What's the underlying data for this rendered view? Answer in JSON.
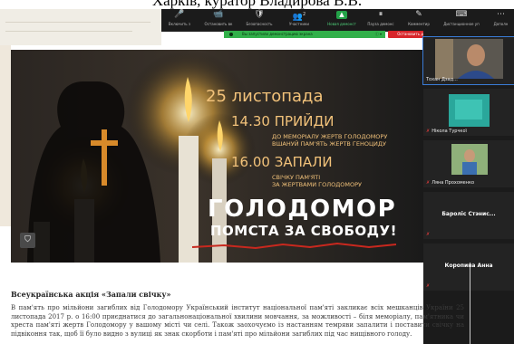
{
  "caption": {
    "text": "Харків, куратор Владирова В.В."
  },
  "zoom_toolbar": {
    "items": [
      {
        "icon": "🎤",
        "label": "Включить з"
      },
      {
        "icon": "📹",
        "label": "Остановить вк"
      },
      {
        "icon": "🛡",
        "label": "Безопасность"
      },
      {
        "icon": "👥",
        "label": "Участники"
      },
      {
        "icon": "▲",
        "label": "Новая демонст"
      },
      {
        "icon": "⏸",
        "label": "Пауза демонс"
      },
      {
        "icon": "✎",
        "label": "Комментир"
      },
      {
        "icon": "⌨",
        "label": "Дистанционное уп"
      },
      {
        "icon": "⋯",
        "label": "Дополн"
      }
    ],
    "participants_count": "2",
    "new_share_badge": "▲",
    "more_icon": "⋯"
  },
  "share_indicator": {
    "text": "Вы запустили демонстрацию экрана",
    "control": "ⓘ ▾"
  },
  "stop_share_button": {
    "label": "Остановить демонстрацию"
  },
  "poster": {
    "date": "25 листопада",
    "time1": "14.30",
    "action1": "ПРИЙДИ",
    "line1a": "ДО МЕМОРІАЛУ ЖЕРТВ ГОЛОДОМОРУ",
    "line1b": "ВШАНУЙ ПАМ'ЯТЬ ЖЕРТВ ГЕНОЦИДУ",
    "time2": "16.00",
    "action2": "ЗАПАЛИ",
    "line2a": "СВІЧКУ ПАМ'ЯТІ",
    "line2b": "ЗА ЖЕРТВАМИ ГОЛОДОМОРУ",
    "headline": "ГОЛОДОМОР",
    "subheadline": "ПОМСТА ЗА СВОБОДУ!",
    "save_icon": "⛉"
  },
  "participants": [
    {
      "name": "Тохан Дзад...",
      "mic": "",
      "type": "video"
    },
    {
      "name": "Нікола Турчкої",
      "mic": "✗",
      "type": "video"
    },
    {
      "name": "Ляна Прохоменко",
      "mic": "✗",
      "type": "video"
    },
    {
      "name": "Бароліс Стэнис...",
      "mic": "✗",
      "type": "name-only"
    },
    {
      "name": "Коропина Анна",
      "mic": "✗",
      "type": "name-only"
    }
  ],
  "article": {
    "title": "Всеукраїнська акція «Запали свічку»",
    "paragraph": "В пам'ять про мільйони загиблих від Голодомору Український інститут національної пам'яті закликає всіх мешканців України 25 листопада 2017 р. о 16:00 приєднатися до загальнонаціональної хвилини мовчання, за можливості – біля меморіалу, пам'ятника чи хреста пам'яті жертв Голодомору у вашому місті чи селі. Також заохочуємо із настанням темряви запалити і поставити свічку на підвіконня так, щоб її було видно з вулиці як знак скорботи і пам'яті про мільйони загиблих під час нищівного голоду."
  },
  "colors": {
    "zoom_bg": "#1b1b1b",
    "share_green": "#32b04a",
    "stop_red": "#d8262b",
    "poster_orange": "#f2c27a",
    "poster_white": "#ffffff",
    "poster_red": "#c8281e"
  }
}
